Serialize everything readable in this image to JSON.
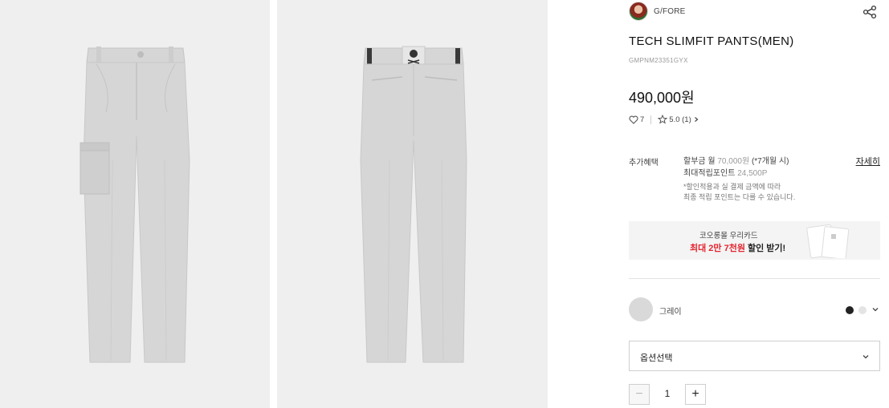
{
  "brand": {
    "name": "G/FORE"
  },
  "product": {
    "title": "TECH SLIMFIT PANTS(MEN)",
    "code": "GMPNM23351GYX",
    "price": "490,000원",
    "likes": "7",
    "rating": "5.0 (1)"
  },
  "benefit": {
    "label": "추가혜택",
    "installment_prefix": "할부금 월",
    "installment_amount": "70,000원",
    "installment_months": "(*7개월 시)",
    "points_label": "최대적립포인트",
    "points_value": "24,500P",
    "note_line1": "*할인적용과 실 결제 금액에 따라",
    "note_line2": "최종 적립 포인트는 다를 수 있습니다.",
    "detail_link": "자세히"
  },
  "card_banner": {
    "line1": "코오롱몰 우리카드",
    "line2_accent": "최대 2만 7천원",
    "line2_rest": " 할인 받기!"
  },
  "color": {
    "selected_name": "그레이",
    "options": [
      "dark",
      "gray"
    ],
    "swatch_color": "#d9d9d9"
  },
  "option_select": {
    "placeholder": "옵션선택"
  },
  "quantity": {
    "value": "1",
    "minus": "−",
    "plus": "+"
  },
  "colors": {
    "accent": "#e4232f",
    "product_gray": "#d4d4d4",
    "photo_bg": "#efefef"
  },
  "icons": [
    "share-icon",
    "heart-icon",
    "star-icon",
    "chevron-right-icon",
    "chevron-down-icon",
    "brand-avatar"
  ]
}
